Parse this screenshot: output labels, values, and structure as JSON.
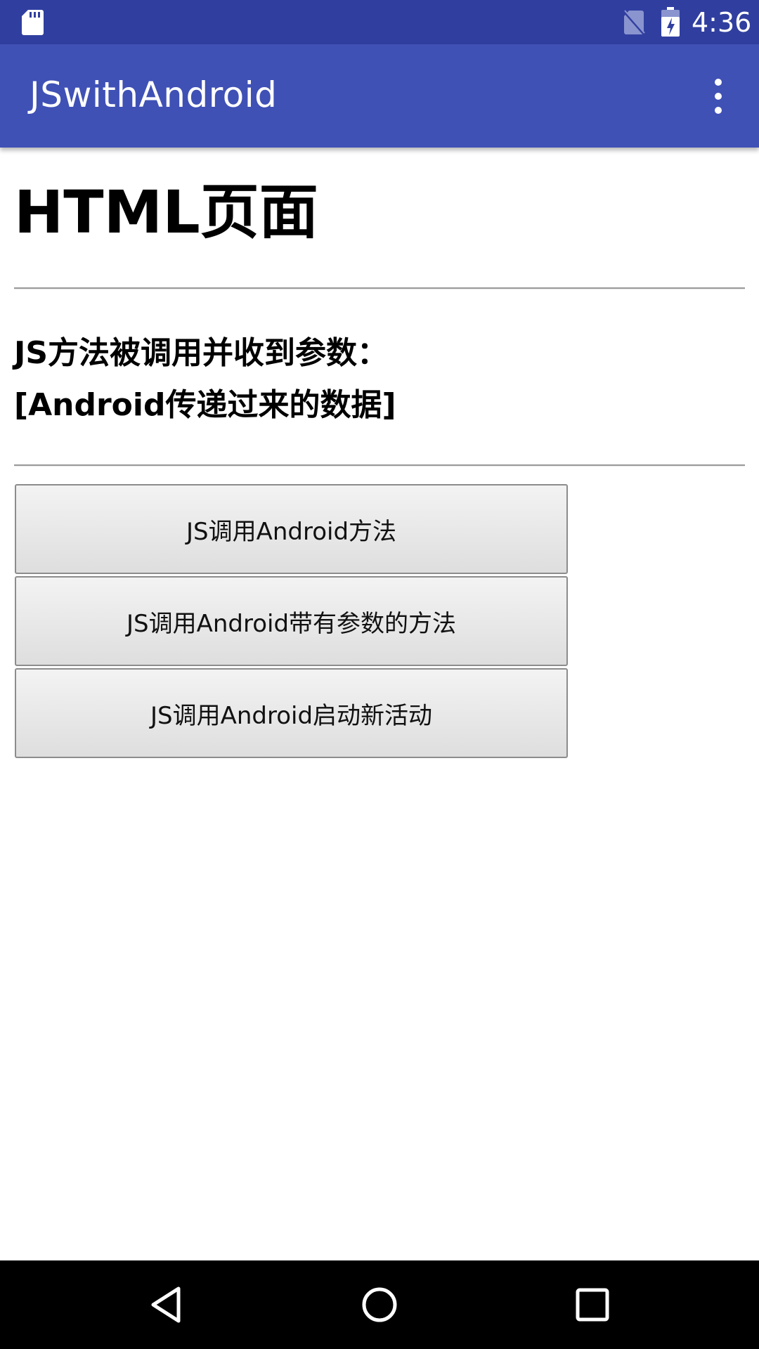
{
  "status_bar": {
    "time": "4:36",
    "icons": [
      "sd-card-icon",
      "no-sim-icon",
      "battery-charging-icon"
    ],
    "background": "#303f9f"
  },
  "app_bar": {
    "title": "JSwithAndroid",
    "overflow_icon": "more-vert-icon",
    "background": "#3f51b5"
  },
  "page": {
    "heading": "HTML页面",
    "message_line1": "JS方法被调用并收到参数：",
    "message_line2": "[Android传递过来的数据]",
    "buttons": [
      {
        "label": "JS调用Android方法"
      },
      {
        "label": "JS调用Android带有参数的方法"
      },
      {
        "label": "JS调用Android启动新活动"
      }
    ]
  },
  "nav_bar": {
    "icons": [
      "back-icon",
      "home-icon",
      "recents-icon"
    ]
  }
}
